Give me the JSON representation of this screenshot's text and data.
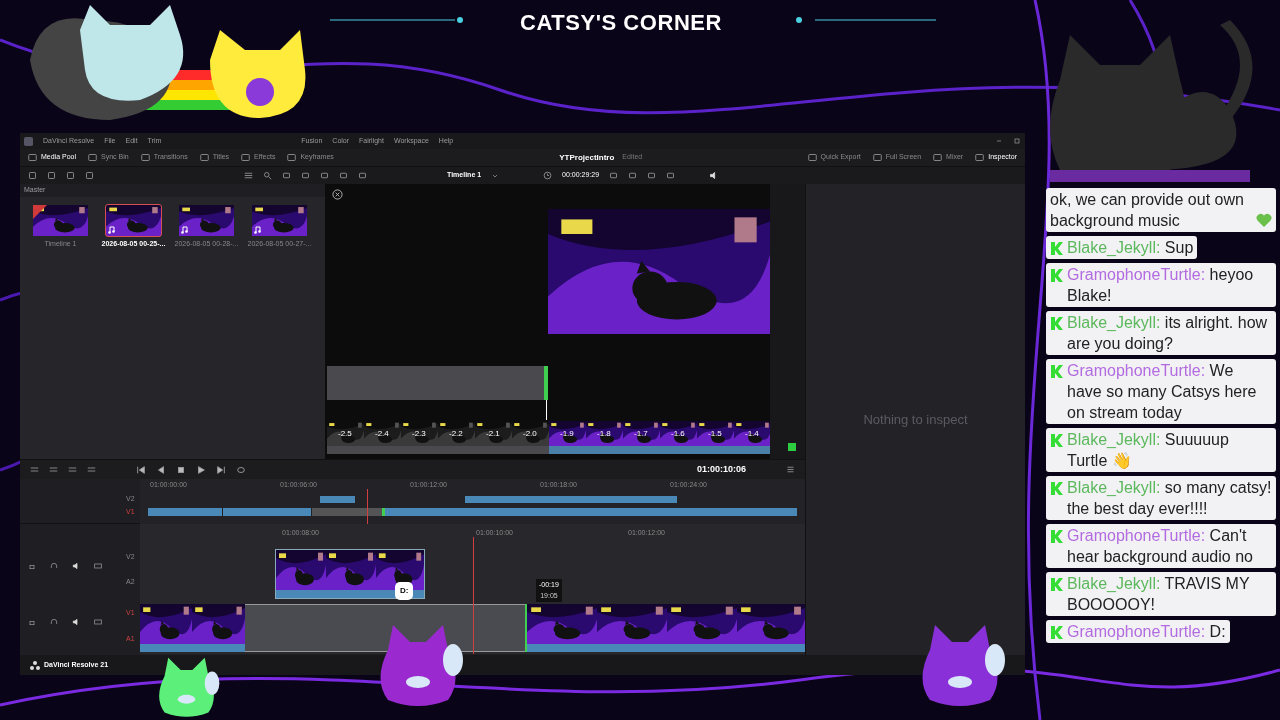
{
  "stream_title": "CATSY'S CORNER",
  "resolve": {
    "menu": [
      "DaVinci Resolve",
      "File",
      "Edit",
      "Trim",
      "Fusion",
      "Color",
      "Fairlight",
      "Workspace",
      "Help"
    ],
    "page_tabs": [
      {
        "label": "Media Pool",
        "selected": true
      },
      {
        "label": "Sync Bin",
        "selected": false
      },
      {
        "label": "Transitions",
        "selected": false
      },
      {
        "label": "Titles",
        "selected": false
      },
      {
        "label": "Effects",
        "selected": false
      },
      {
        "label": "Keyframes",
        "selected": false
      }
    ],
    "project": {
      "name": "YTProjectIntro",
      "status": "Edited"
    },
    "right_tabs": [
      {
        "label": "Quick Export",
        "selected": false
      },
      {
        "label": "Full Screen",
        "selected": false
      },
      {
        "label": "Mixer",
        "selected": false
      },
      {
        "label": "Inspector",
        "selected": true
      }
    ],
    "timeline_name": "Timeline 1",
    "duration": "00:00:29:29",
    "media_pool": {
      "folder": "Master",
      "clips": [
        {
          "name": "Timeline 1",
          "kind": "timeline",
          "selected": false
        },
        {
          "name": "2026-08-05 00-25-...",
          "kind": "audio",
          "selected": true
        },
        {
          "name": "2026-08-05 00-28-...",
          "kind": "audio",
          "selected": false
        },
        {
          "name": "2026-08-05 00-27-...",
          "kind": "audio",
          "selected": false
        }
      ]
    },
    "trim_frames": [
      {
        "label": "-2.5",
        "kind": "outgoing"
      },
      {
        "label": "-2.4",
        "kind": "outgoing"
      },
      {
        "label": "-2.3",
        "kind": "outgoing"
      },
      {
        "label": "-2.2",
        "kind": "outgoing"
      },
      {
        "label": "-2.1",
        "kind": "outgoing"
      },
      {
        "label": "-2.0",
        "kind": "outgoing"
      },
      {
        "label": "-1.9",
        "kind": "incoming"
      },
      {
        "label": "-1.8",
        "kind": "incoming"
      },
      {
        "label": "-1.7",
        "kind": "incoming"
      },
      {
        "label": "-1.6",
        "kind": "incoming"
      },
      {
        "label": "-1.5",
        "kind": "incoming"
      },
      {
        "label": "-1.4",
        "kind": "incoming"
      }
    ],
    "inspector": {
      "empty_text": "Nothing to inspect"
    },
    "timecode": "01:00:10:06",
    "mini_ruler": [
      "01:00:00:00",
      "01:00:06:00",
      "01:00:12:00",
      "01:00:18:00",
      "01:00:24:00"
    ],
    "mini_tracks": [
      {
        "label": "V2",
        "targeted": false
      },
      {
        "label": "V1",
        "targeted": true
      }
    ],
    "ruler": [
      "01:00:08:00",
      "01:00:10:00",
      "01:00:12:00"
    ],
    "tracks": [
      {
        "video": "V2",
        "audio": "A2",
        "targeted": false
      },
      {
        "video": "V1",
        "audio": "A1",
        "targeted": true
      }
    ],
    "trim_tooltip": {
      "offset": "-00:19",
      "time": "19:05"
    },
    "product": "DaVinci Resolve 21"
  },
  "speech_bubble": "D:",
  "chat": [
    {
      "text": "ok, we can provide out own background music",
      "heart": true
    },
    {
      "user": "Blake_Jekyll:",
      "color": "#5cb85c",
      "text": "Sup"
    },
    {
      "user": "GramophoneTurtle:",
      "color": "#b36be0",
      "text": "heyoo Blake!"
    },
    {
      "user": "Blake_Jekyll:",
      "color": "#5cb85c",
      "text": "its alright. how are you doing?"
    },
    {
      "user": "GramophoneTurtle:",
      "color": "#b36be0",
      "text": "We have so many Catsys here on stream today"
    },
    {
      "user": "Blake_Jekyll:",
      "color": "#5cb85c",
      "text": "Suuuuup Turtle 👋"
    },
    {
      "user": "Blake_Jekyll:",
      "color": "#5cb85c",
      "text": "so many catsy! the best day ever!!!!"
    },
    {
      "user": "GramophoneTurtle:",
      "color": "#b36be0",
      "text": "Can't hear background audio no"
    },
    {
      "user": "Blake_Jekyll:",
      "color": "#5cb85c",
      "text": "TRAVIS MY BOOOOOY!"
    },
    {
      "user": "GramophoneTurtle:",
      "color": "#b36be0",
      "text": "D:"
    }
  ]
}
